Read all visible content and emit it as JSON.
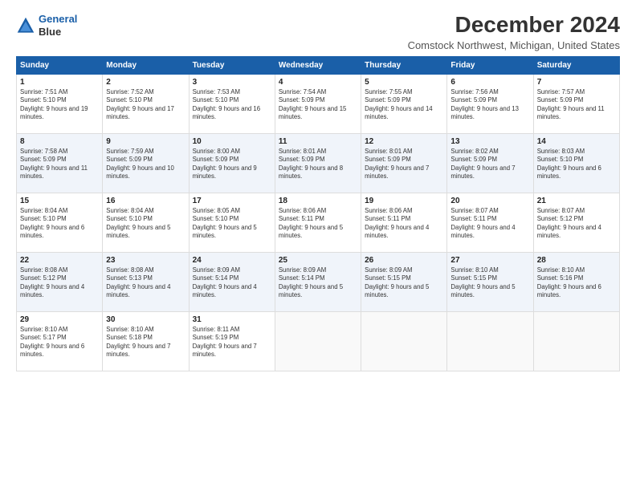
{
  "header": {
    "logo_line1": "General",
    "logo_line2": "Blue",
    "month": "December 2024",
    "location": "Comstock Northwest, Michigan, United States"
  },
  "weekdays": [
    "Sunday",
    "Monday",
    "Tuesday",
    "Wednesday",
    "Thursday",
    "Friday",
    "Saturday"
  ],
  "weeks": [
    [
      {
        "day": "1",
        "sunrise": "Sunrise: 7:51 AM",
        "sunset": "Sunset: 5:10 PM",
        "daylight": "Daylight: 9 hours and 19 minutes."
      },
      {
        "day": "2",
        "sunrise": "Sunrise: 7:52 AM",
        "sunset": "Sunset: 5:10 PM",
        "daylight": "Daylight: 9 hours and 17 minutes."
      },
      {
        "day": "3",
        "sunrise": "Sunrise: 7:53 AM",
        "sunset": "Sunset: 5:10 PM",
        "daylight": "Daylight: 9 hours and 16 minutes."
      },
      {
        "day": "4",
        "sunrise": "Sunrise: 7:54 AM",
        "sunset": "Sunset: 5:09 PM",
        "daylight": "Daylight: 9 hours and 15 minutes."
      },
      {
        "day": "5",
        "sunrise": "Sunrise: 7:55 AM",
        "sunset": "Sunset: 5:09 PM",
        "daylight": "Daylight: 9 hours and 14 minutes."
      },
      {
        "day": "6",
        "sunrise": "Sunrise: 7:56 AM",
        "sunset": "Sunset: 5:09 PM",
        "daylight": "Daylight: 9 hours and 13 minutes."
      },
      {
        "day": "7",
        "sunrise": "Sunrise: 7:57 AM",
        "sunset": "Sunset: 5:09 PM",
        "daylight": "Daylight: 9 hours and 11 minutes."
      }
    ],
    [
      {
        "day": "8",
        "sunrise": "Sunrise: 7:58 AM",
        "sunset": "Sunset: 5:09 PM",
        "daylight": "Daylight: 9 hours and 11 minutes."
      },
      {
        "day": "9",
        "sunrise": "Sunrise: 7:59 AM",
        "sunset": "Sunset: 5:09 PM",
        "daylight": "Daylight: 9 hours and 10 minutes."
      },
      {
        "day": "10",
        "sunrise": "Sunrise: 8:00 AM",
        "sunset": "Sunset: 5:09 PM",
        "daylight": "Daylight: 9 hours and 9 minutes."
      },
      {
        "day": "11",
        "sunrise": "Sunrise: 8:01 AM",
        "sunset": "Sunset: 5:09 PM",
        "daylight": "Daylight: 9 hours and 8 minutes."
      },
      {
        "day": "12",
        "sunrise": "Sunrise: 8:01 AM",
        "sunset": "Sunset: 5:09 PM",
        "daylight": "Daylight: 9 hours and 7 minutes."
      },
      {
        "day": "13",
        "sunrise": "Sunrise: 8:02 AM",
        "sunset": "Sunset: 5:09 PM",
        "daylight": "Daylight: 9 hours and 7 minutes."
      },
      {
        "day": "14",
        "sunrise": "Sunrise: 8:03 AM",
        "sunset": "Sunset: 5:10 PM",
        "daylight": "Daylight: 9 hours and 6 minutes."
      }
    ],
    [
      {
        "day": "15",
        "sunrise": "Sunrise: 8:04 AM",
        "sunset": "Sunset: 5:10 PM",
        "daylight": "Daylight: 9 hours and 6 minutes."
      },
      {
        "day": "16",
        "sunrise": "Sunrise: 8:04 AM",
        "sunset": "Sunset: 5:10 PM",
        "daylight": "Daylight: 9 hours and 5 minutes."
      },
      {
        "day": "17",
        "sunrise": "Sunrise: 8:05 AM",
        "sunset": "Sunset: 5:10 PM",
        "daylight": "Daylight: 9 hours and 5 minutes."
      },
      {
        "day": "18",
        "sunrise": "Sunrise: 8:06 AM",
        "sunset": "Sunset: 5:11 PM",
        "daylight": "Daylight: 9 hours and 5 minutes."
      },
      {
        "day": "19",
        "sunrise": "Sunrise: 8:06 AM",
        "sunset": "Sunset: 5:11 PM",
        "daylight": "Daylight: 9 hours and 4 minutes."
      },
      {
        "day": "20",
        "sunrise": "Sunrise: 8:07 AM",
        "sunset": "Sunset: 5:11 PM",
        "daylight": "Daylight: 9 hours and 4 minutes."
      },
      {
        "day": "21",
        "sunrise": "Sunrise: 8:07 AM",
        "sunset": "Sunset: 5:12 PM",
        "daylight": "Daylight: 9 hours and 4 minutes."
      }
    ],
    [
      {
        "day": "22",
        "sunrise": "Sunrise: 8:08 AM",
        "sunset": "Sunset: 5:12 PM",
        "daylight": "Daylight: 9 hours and 4 minutes."
      },
      {
        "day": "23",
        "sunrise": "Sunrise: 8:08 AM",
        "sunset": "Sunset: 5:13 PM",
        "daylight": "Daylight: 9 hours and 4 minutes."
      },
      {
        "day": "24",
        "sunrise": "Sunrise: 8:09 AM",
        "sunset": "Sunset: 5:14 PM",
        "daylight": "Daylight: 9 hours and 4 minutes."
      },
      {
        "day": "25",
        "sunrise": "Sunrise: 8:09 AM",
        "sunset": "Sunset: 5:14 PM",
        "daylight": "Daylight: 9 hours and 5 minutes."
      },
      {
        "day": "26",
        "sunrise": "Sunrise: 8:09 AM",
        "sunset": "Sunset: 5:15 PM",
        "daylight": "Daylight: 9 hours and 5 minutes."
      },
      {
        "day": "27",
        "sunrise": "Sunrise: 8:10 AM",
        "sunset": "Sunset: 5:15 PM",
        "daylight": "Daylight: 9 hours and 5 minutes."
      },
      {
        "day": "28",
        "sunrise": "Sunrise: 8:10 AM",
        "sunset": "Sunset: 5:16 PM",
        "daylight": "Daylight: 9 hours and 6 minutes."
      }
    ],
    [
      {
        "day": "29",
        "sunrise": "Sunrise: 8:10 AM",
        "sunset": "Sunset: 5:17 PM",
        "daylight": "Daylight: 9 hours and 6 minutes."
      },
      {
        "day": "30",
        "sunrise": "Sunrise: 8:10 AM",
        "sunset": "Sunset: 5:18 PM",
        "daylight": "Daylight: 9 hours and 7 minutes."
      },
      {
        "day": "31",
        "sunrise": "Sunrise: 8:11 AM",
        "sunset": "Sunset: 5:19 PM",
        "daylight": "Daylight: 9 hours and 7 minutes."
      },
      null,
      null,
      null,
      null
    ]
  ]
}
